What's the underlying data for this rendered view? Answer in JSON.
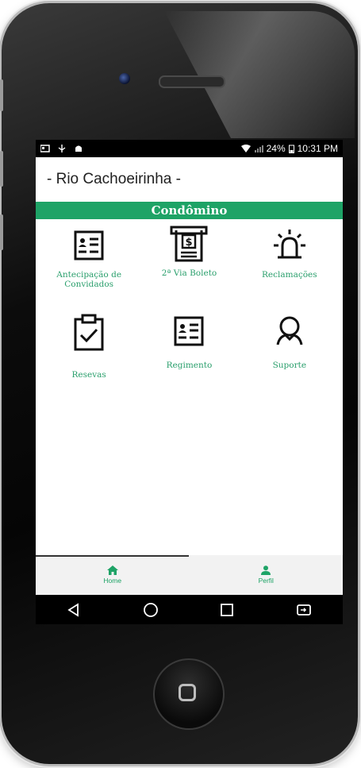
{
  "status_bar": {
    "battery": "24%",
    "time": "10:31 PM"
  },
  "app_bar": {
    "title": "- Rio Cachoeirinha -"
  },
  "section": {
    "title": "Condômino"
  },
  "menu": [
    {
      "label": "Antecipação de Convidados",
      "icon": "id-card-icon"
    },
    {
      "label": "2ª Via Boleto",
      "icon": "receipt-icon"
    },
    {
      "label": "Reclamações",
      "icon": "siren-icon"
    },
    {
      "label": "Resevas",
      "icon": "clipboard-check-icon"
    },
    {
      "label": "Regimento",
      "icon": "id-card-icon"
    },
    {
      "label": "Suporte",
      "icon": "support-person-icon"
    }
  ],
  "bottom_nav": [
    {
      "label": "Home",
      "icon": "home-icon",
      "active": true
    },
    {
      "label": "Perfil",
      "icon": "person-icon",
      "active": false
    }
  ],
  "system_nav": [
    "back-icon",
    "home-circle-icon",
    "recents-icon",
    "screen-mirror-icon"
  ],
  "colors": {
    "accent": "#1ea366",
    "label": "#2a9f6c",
    "statusbar": "#000000"
  }
}
